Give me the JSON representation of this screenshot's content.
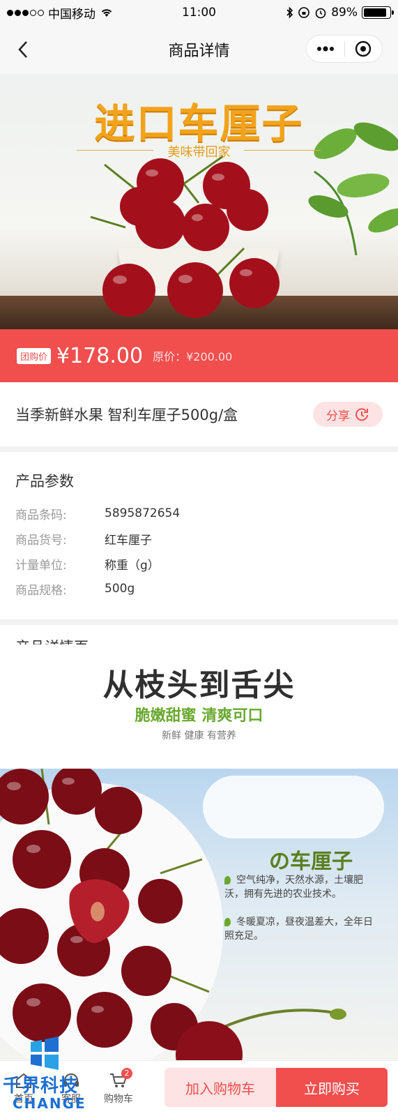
{
  "status_bar": {
    "carrier": "中国移动",
    "time": "11:00",
    "battery": "89%"
  },
  "nav": {
    "title": "商品详情"
  },
  "hero": {
    "title": "进口车厘子",
    "subtitle": "美味带回家"
  },
  "price": {
    "tag": "团购价",
    "current": "¥178.00",
    "original": "原价：¥200.00"
  },
  "product": {
    "name": "当季新鲜水果 智利车厘子500g/盒",
    "share_label": "分享"
  },
  "params": {
    "title": "产品参数",
    "rows": [
      {
        "key": "商品条码:",
        "value": "5895872654"
      },
      {
        "key": "商品货号:",
        "value": "红车厘子"
      },
      {
        "key": "计量单位:",
        "value": "称重（g）"
      },
      {
        "key": "商品规格:",
        "value": "500g"
      }
    ]
  },
  "detail": {
    "title": "产品详情页",
    "image_title": "从枝头到舌尖",
    "image_subtitle": "脆嫩甜蜜 清爽可口",
    "image_tags": "新鲜   健康   有营养",
    "brand": "の车厘子",
    "bullet_1": "空气纯净，天然水源，土壤肥沃，拥有先进的农业技术。",
    "bullet_2": "冬暖夏凉，昼夜温差大，全年日照充足。"
  },
  "bottom_bar": {
    "home_label": "首页",
    "service_label": "客服",
    "cart_label": "购物车",
    "cart_count": "2",
    "add_to_cart": "加入购物车",
    "buy_now": "立即购买"
  },
  "watermark": {
    "text_cn": "千界科技",
    "text_en": "CHANGE"
  },
  "colors": {
    "accent": "#f14e4e",
    "accent_light": "#fde3e3",
    "hero_title": "#f2a31a",
    "detail_green": "#6aa82f"
  }
}
